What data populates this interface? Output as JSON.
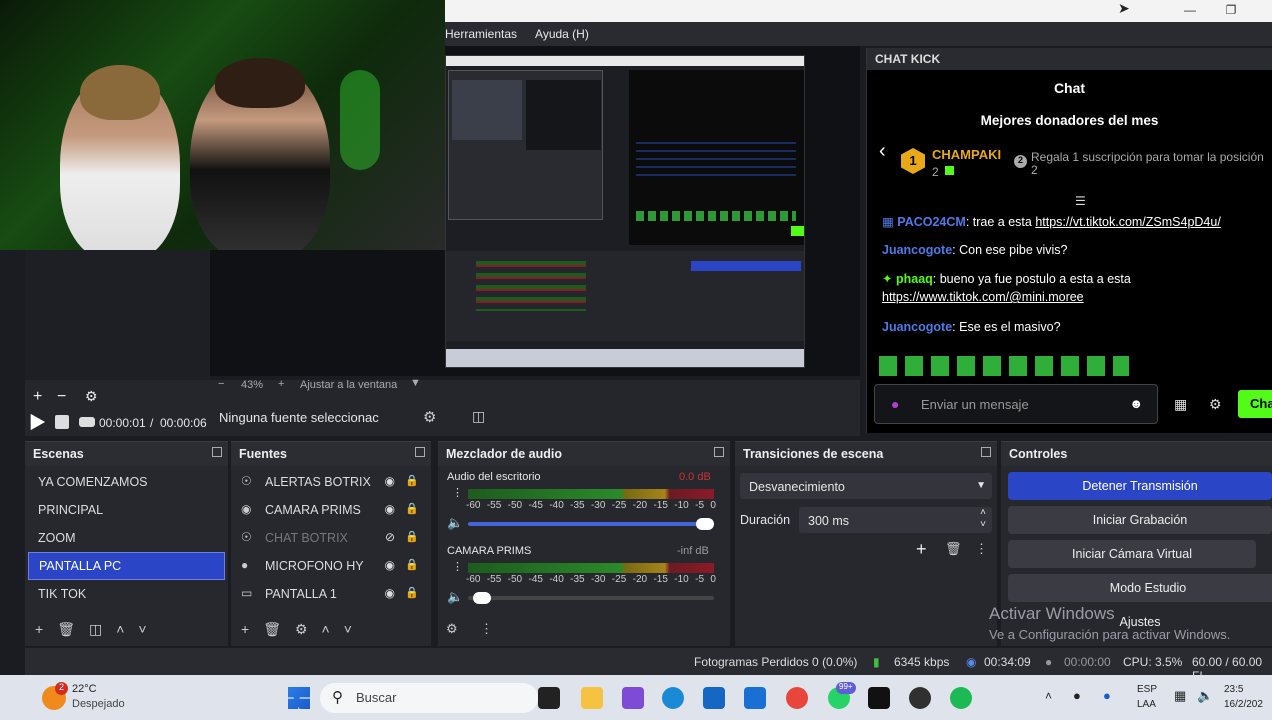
{
  "menu": {
    "items": [
      "Herramientas",
      "Ayuda (H)"
    ]
  },
  "preview": {
    "zoom": "43%",
    "fit_label": "Ajustar a la ventana"
  },
  "media": {
    "time_current": "00:00:01",
    "time_separator": "/",
    "time_total": "00:00:06"
  },
  "source_bar": {
    "no_source": "Ninguna fuente seleccionac"
  },
  "chat": {
    "panel_title": "CHAT KICK",
    "title": "Chat",
    "donors_title": "Mejores donadores del mes",
    "top_donor": {
      "rank": "1",
      "name": "CHAMPAKI",
      "amount": "2"
    },
    "gift_prompt": "Regala 1 suscripción para tomar la posición",
    "gift_rank": "2",
    "messages": [
      {
        "user": "PACO24CM",
        "sep": ": ",
        "text": "trae a esta ",
        "link": "https://vt.tiktok.com/ZSmS4pD4u/"
      },
      {
        "user": "Juancogote",
        "sep": ": ",
        "text": "Con ese pibe vivis?",
        "link": ""
      },
      {
        "user": "phaaq",
        "sep": ": ",
        "text": "bueno ya fue postulo a esta a esta",
        "link": "https://www.tiktok.com/@mini.moree"
      },
      {
        "user": "Juancogote",
        "sep": ": ",
        "text": "Ese es el masivo?",
        "link": ""
      }
    ],
    "input_placeholder": "Enviar un mensaje",
    "send_label": "Cha"
  },
  "scenes": {
    "title": "Escenas",
    "items": [
      "YA COMENZAMOS",
      "PRINCIPAL",
      "ZOOM",
      "PANTALLA PC",
      "TIK TOK"
    ],
    "selected": "PANTALLA PC"
  },
  "sources": {
    "title": "Fuentes",
    "items": [
      {
        "label": "ALERTAS BOTRIX",
        "icon": "globe-icon",
        "visible": true
      },
      {
        "label": "CAMARA PRIMS",
        "icon": "camera-icon",
        "visible": true
      },
      {
        "label": "CHAT BOTRIX",
        "icon": "globe-icon",
        "visible": false
      },
      {
        "label": "MICROFONO HY",
        "icon": "microphone-icon",
        "visible": true
      },
      {
        "label": "PANTALLA 1",
        "icon": "monitor-icon",
        "visible": true
      }
    ]
  },
  "mixer": {
    "title": "Mezclador de audio",
    "channels": [
      {
        "name": "Audio del escritorio",
        "level": "0.0 dB",
        "volume": 1.0
      },
      {
        "name": "CAMARA PRIMS",
        "level": "-inf dB",
        "volume": 0.02
      }
    ],
    "ticks": [
      "-60",
      "-55",
      "-50",
      "-45",
      "-40",
      "-35",
      "-30",
      "-25",
      "-20",
      "-15",
      "-10",
      "-5",
      "0"
    ]
  },
  "transitions": {
    "title": "Transiciones de escena",
    "selected": "Desvanecimiento",
    "duration_label": "Duración",
    "duration_value": "300 ms"
  },
  "controls": {
    "title": "Controles",
    "buttons": [
      "Detener Transmisión",
      "Iniciar Grabación",
      "Iniciar Cámara Virtual",
      "Modo Estudio",
      "Ajustes"
    ]
  },
  "watermark": {
    "line1": "Activar Windows",
    "line2": "Ve a Configuración para activar Windows."
  },
  "status": {
    "dropped": "Fotogramas Perdidos 0 (0.0%)",
    "bitrate": "6345 kbps",
    "stream_time": "00:34:09",
    "rec_time": "00:00:00",
    "cpu": "CPU: 3.5%",
    "fps": "60.00 / 60.00 FI"
  },
  "taskbar": {
    "weather_temp": "22°C",
    "weather_desc": "Despejado",
    "weather_badge": "2",
    "search": "Buscar",
    "whatsapp_badge": "99+",
    "lang_top": "ESP",
    "lang_bottom": "LAA",
    "time": "23:5",
    "date": "16/2/202"
  },
  "colors": {
    "accent_blue": "#2a46c7",
    "kick_green": "#53fc18",
    "chat_user_blue": "#4e7ae8"
  }
}
